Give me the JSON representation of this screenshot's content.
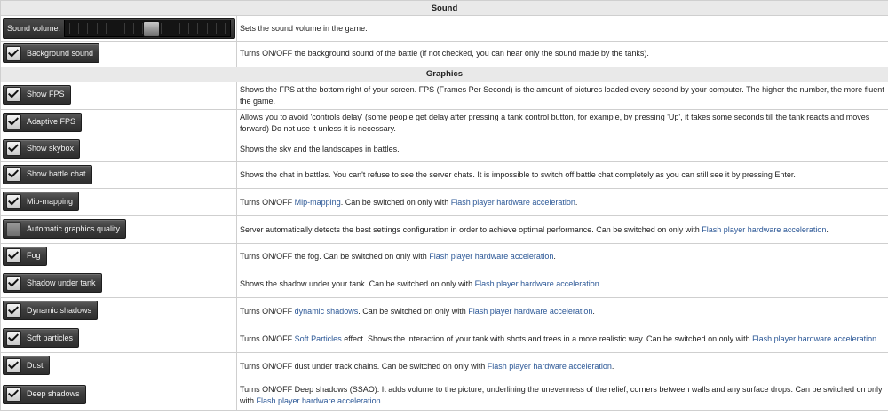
{
  "sound": {
    "header": "Sound",
    "volume": {
      "label": "Sound volume:",
      "desc": "Sets the sound volume in the game.",
      "level_percent": 52
    },
    "background": {
      "label": "Background sound",
      "checked": true,
      "desc": "Turns ON/OFF the background sound of the battle (if not checked, you can hear only the sound made by the tanks)."
    }
  },
  "graphics": {
    "header": "Graphics",
    "rows": [
      {
        "label": "Show FPS",
        "checked": true,
        "segments": [
          {
            "text": "Shows the FPS at the bottom right of your screen. FPS (Frames Per Second) is the amount of pictures loaded every second by your computer. The higher the number, the more fluent the game."
          }
        ]
      },
      {
        "label": "Adaptive FPS",
        "checked": true,
        "segments": [
          {
            "text": "Allows you to avoid 'controls delay' (some people get delay after pressing a tank control button, for example, by pressing 'Up', it takes some seconds till the tank reacts and moves forward) Do not use it unless it is necessary."
          }
        ]
      },
      {
        "label": "Show skybox",
        "checked": true,
        "segments": [
          {
            "text": "Shows the sky and the landscapes in battles."
          }
        ]
      },
      {
        "label": "Show battle chat",
        "checked": true,
        "segments": [
          {
            "text": "Shows the chat in battles. You can't refuse to see the server chats. It is impossible to switch off battle chat completely as you can still see it by pressing Enter."
          }
        ]
      },
      {
        "label": "Mip-mapping",
        "checked": true,
        "segments": [
          {
            "text": "Turns ON/OFF "
          },
          {
            "text": "Mip-mapping",
            "link": true
          },
          {
            "text": ". Can be switched on only with "
          },
          {
            "text": "Flash player hardware acceleration",
            "link": true
          },
          {
            "text": "."
          }
        ]
      },
      {
        "label": "Automatic graphics quality",
        "checked": false,
        "segments": [
          {
            "text": "Server automatically detects the best settings configuration in order to achieve optimal performance. Can be switched on only with "
          },
          {
            "text": "Flash player hardware acceleration",
            "link": true
          },
          {
            "text": "."
          }
        ]
      },
      {
        "label": "Fog",
        "checked": true,
        "segments": [
          {
            "text": "Turns ON/OFF the fog. Can be switched on only with "
          },
          {
            "text": "Flash player hardware acceleration",
            "link": true
          },
          {
            "text": "."
          }
        ]
      },
      {
        "label": "Shadow under tank",
        "checked": true,
        "segments": [
          {
            "text": "Shows the shadow under your tank. Can be switched on only with "
          },
          {
            "text": "Flash player hardware acceleration",
            "link": true
          },
          {
            "text": "."
          }
        ]
      },
      {
        "label": "Dynamic shadows",
        "checked": true,
        "segments": [
          {
            "text": "Turns ON/OFF "
          },
          {
            "text": "dynamic shadows",
            "link": true
          },
          {
            "text": ". Can be switched on only with "
          },
          {
            "text": "Flash player hardware acceleration",
            "link": true
          },
          {
            "text": "."
          }
        ]
      },
      {
        "label": "Soft particles",
        "checked": true,
        "segments": [
          {
            "text": "Turns ON/OFF "
          },
          {
            "text": "Soft Particles",
            "link": true
          },
          {
            "text": " effect. Shows the interaction of your tank with shots and trees in a more realistic way. Can be switched on only with "
          },
          {
            "text": "Flash player hardware acceleration",
            "link": true
          },
          {
            "text": "."
          }
        ]
      },
      {
        "label": "Dust",
        "checked": true,
        "segments": [
          {
            "text": "Turns ON/OFF dust under track chains. Can be switched on only with "
          },
          {
            "text": "Flash player hardware acceleration",
            "link": true
          },
          {
            "text": "."
          }
        ]
      },
      {
        "label": "Deep shadows",
        "checked": true,
        "segments": [
          {
            "text": "Turns ON/OFF Deep shadows (SSAO). It adds volume to the picture, underlining the unevenness of the relief, corners between walls and any surface drops. Can be switched on only with "
          },
          {
            "text": "Flash player hardware acceleration",
            "link": true
          },
          {
            "text": "."
          }
        ]
      }
    ]
  },
  "colors": {
    "link": "#2b5796",
    "header_bg": "#e9e9e9",
    "border": "#cfcfcf"
  }
}
